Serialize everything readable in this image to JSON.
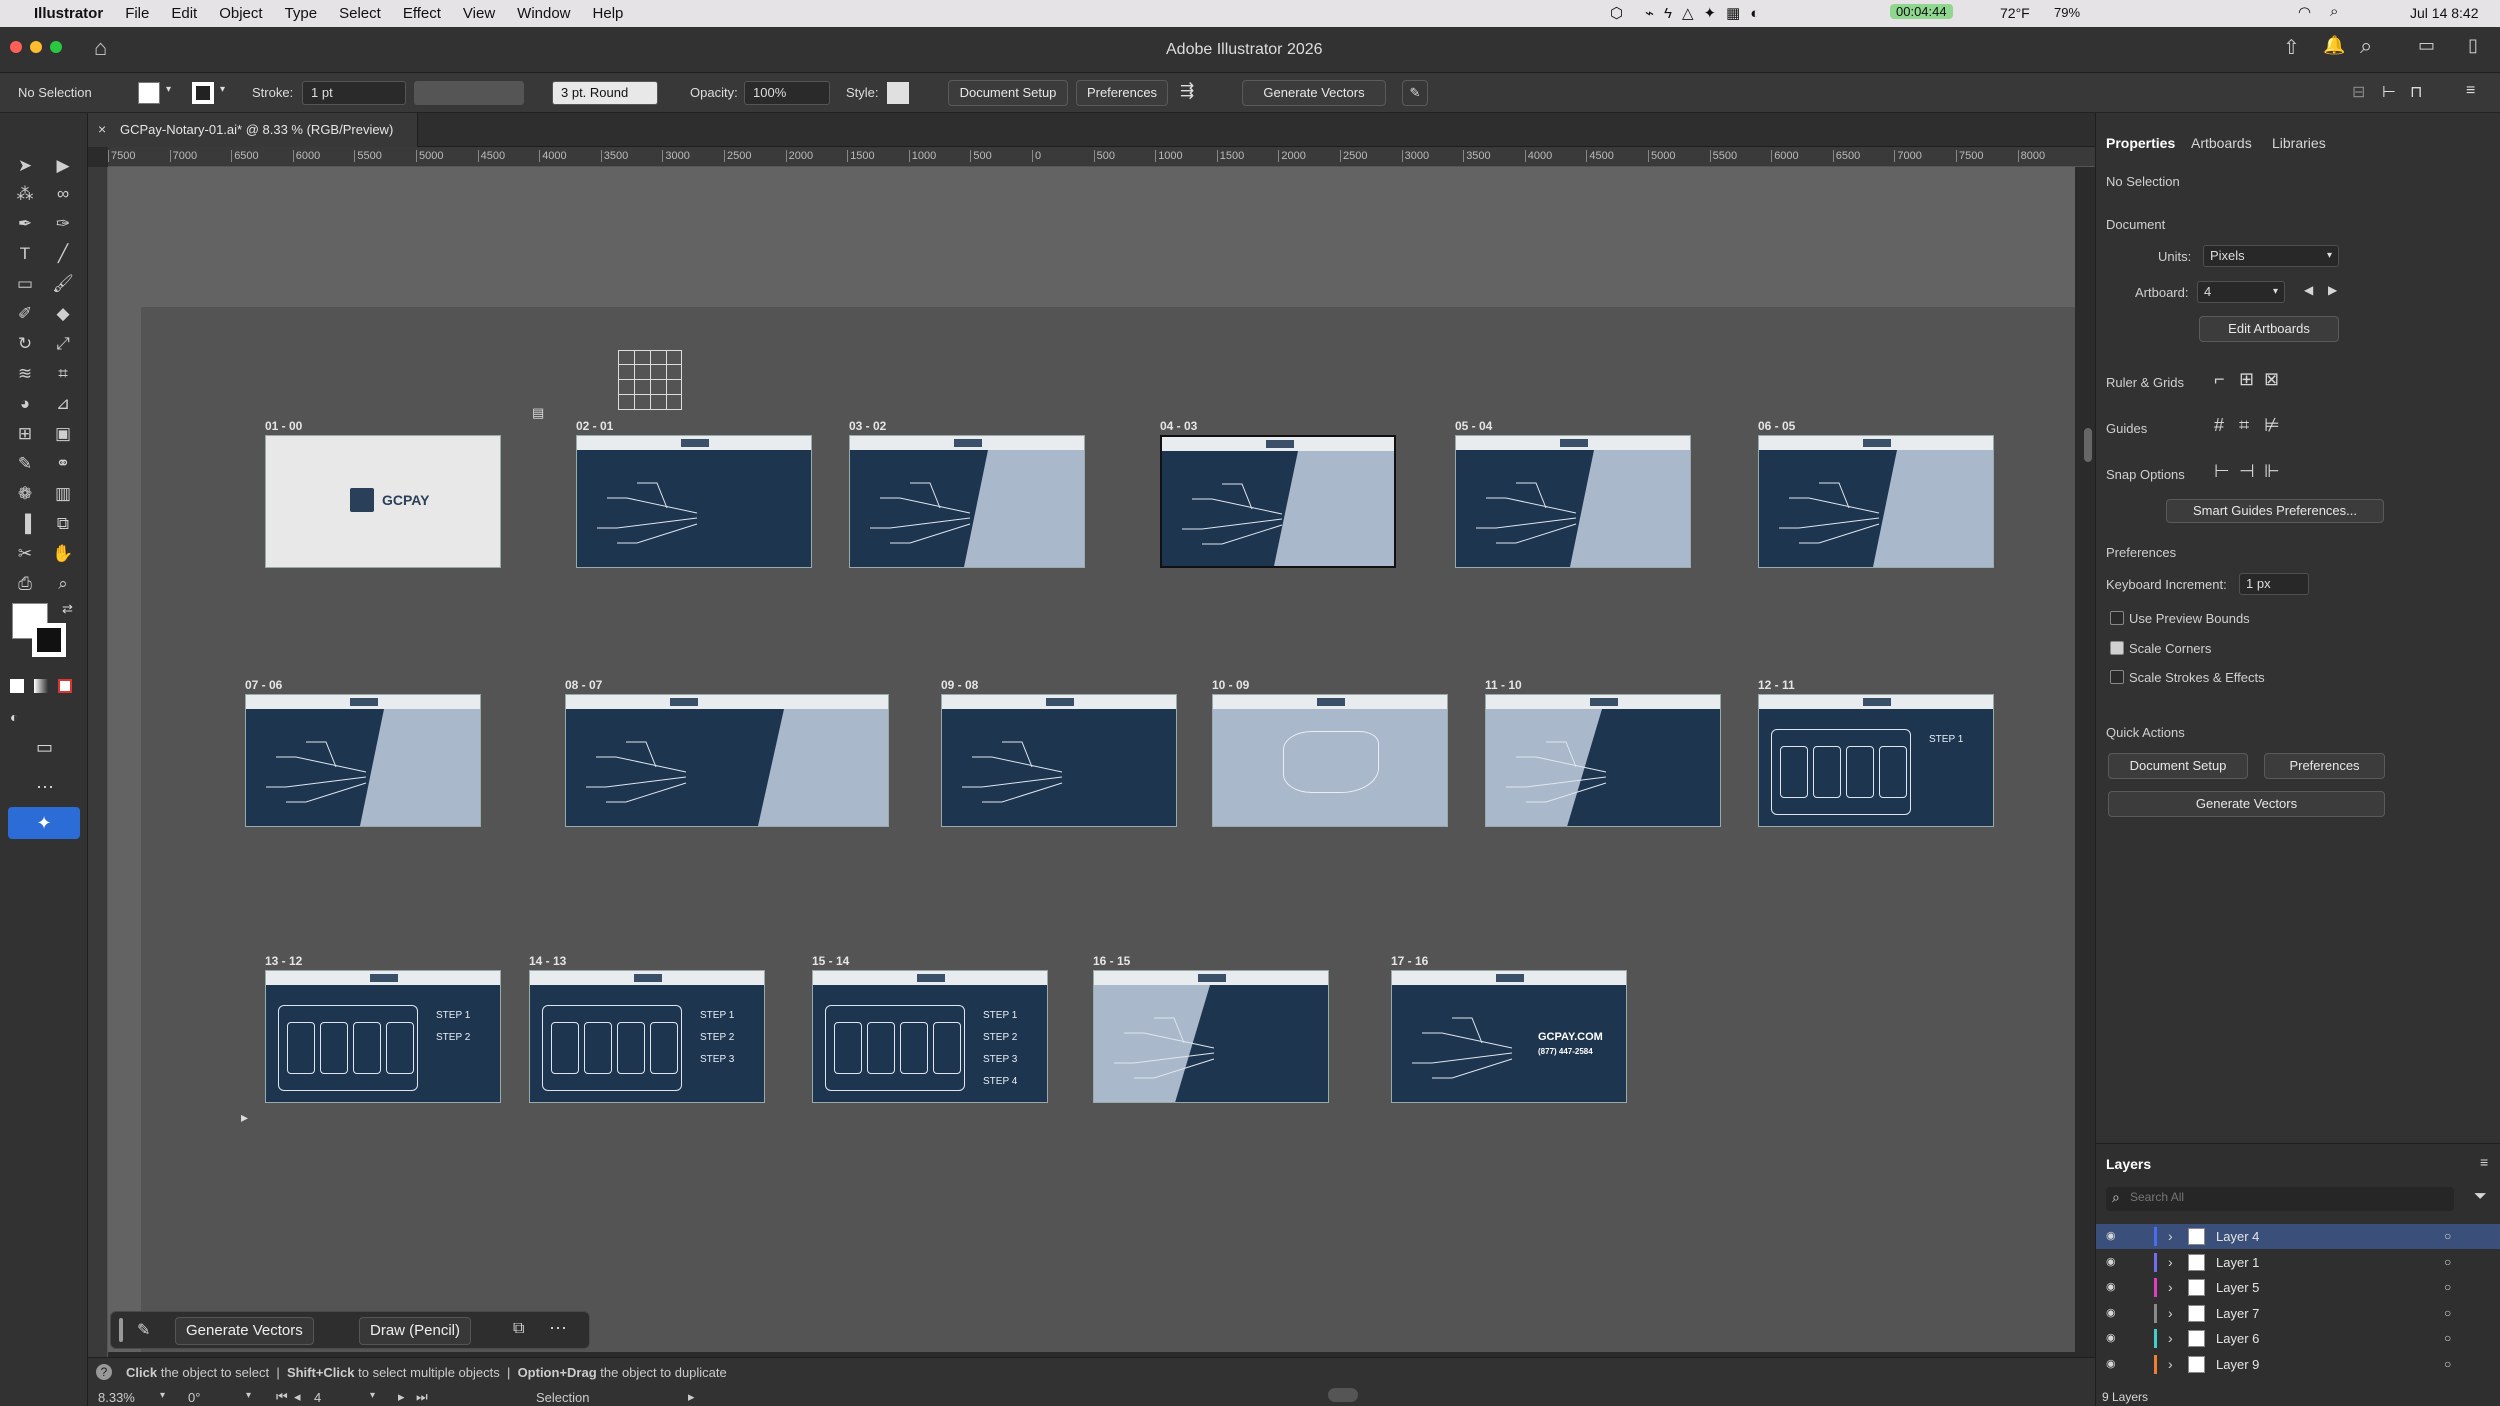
{
  "menubar": {
    "app": "Illustrator",
    "items": [
      "File",
      "Edit",
      "Object",
      "Type",
      "Select",
      "Effect",
      "View",
      "Window",
      "Help"
    ],
    "timer": "00:04:44",
    "weather": "72°F",
    "battery": "79%",
    "datetime": "Jul 14  8:42"
  },
  "window": {
    "title": "Adobe Illustrator 2026"
  },
  "control": {
    "selection": "No Selection",
    "stroke_label": "Stroke:",
    "stroke_value": "1 pt",
    "brush": "3 pt. Round",
    "opacity_label": "Opacity:",
    "opacity_value": "100%",
    "style_label": "Style:",
    "document_setup": "Document Setup",
    "preferences": "Preferences",
    "generate_vectors": "Generate Vectors"
  },
  "doc_tab": {
    "title": "GCPay-Notary-01.ai* @ 8.33 % (RGB/Preview)"
  },
  "ruler": {
    "h_ticks": [
      "7500",
      "7000",
      "6500",
      "6000",
      "5500",
      "5000",
      "4500",
      "4000",
      "3500",
      "3000",
      "2500",
      "2000",
      "1500",
      "1000",
      "500",
      "0",
      "500",
      "1000",
      "1500",
      "2000",
      "2500",
      "3000",
      "3500",
      "4000",
      "4500",
      "5000",
      "5500",
      "6000",
      "6500",
      "7000",
      "7500",
      "8000"
    ]
  },
  "artboards": [
    {
      "label": "01 - 00",
      "text": "GCPAY",
      "style": "cover"
    },
    {
      "label": "02 - 01",
      "style": "dark"
    },
    {
      "label": "03 - 02",
      "style": "split"
    },
    {
      "label": "04 - 03",
      "style": "split"
    },
    {
      "label": "05 - 04",
      "style": "split"
    },
    {
      "label": "06 - 05",
      "style": "split"
    },
    {
      "label": "07 - 06",
      "style": "split"
    },
    {
      "label": "08 - 07",
      "style": "split-wide"
    },
    {
      "label": "09 - 08",
      "style": "dark"
    },
    {
      "label": "10 - 09",
      "style": "light"
    },
    {
      "label": "11 - 10",
      "style": "split-left"
    },
    {
      "label": "12 - 11",
      "style": "steps",
      "step_text": "STEP 1"
    },
    {
      "label": "13 - 12",
      "style": "steps",
      "step_text": "STEP 1\nSTEP 2"
    },
    {
      "label": "14 - 13",
      "style": "steps",
      "step_text": "STEP 1\nSTEP 2\nSTEP 3"
    },
    {
      "label": "15 - 14",
      "style": "steps",
      "step_text": "STEP 1\nSTEP 2\nSTEP 3\nSTEP 4"
    },
    {
      "label": "16 - 15",
      "style": "split-left"
    },
    {
      "label": "17 - 16",
      "style": "contact",
      "url": "GCPAY.COM",
      "phone": "(877) 447-2584"
    }
  ],
  "right_panel": {
    "tabs": [
      "Properties",
      "Artboards",
      "Libraries"
    ],
    "no_selection": "No Selection",
    "document": "Document",
    "units_label": "Units:",
    "units_value": "Pixels",
    "artboard_label": "Artboard:",
    "artboard_value": "4",
    "edit_artboards": "Edit Artboards",
    "ruler_grids": "Ruler & Grids",
    "guides": "Guides",
    "snap_options": "Snap Options",
    "smart_guides": "Smart Guides Preferences...",
    "preferences_title": "Preferences",
    "keyboard_increment_label": "Keyboard Increment:",
    "keyboard_increment_value": "1 px",
    "use_preview_bounds": "Use Preview Bounds",
    "scale_corners": "Scale Corners",
    "scale_strokes": "Scale Strokes & Effects",
    "quick_actions": "Quick Actions",
    "qa_document_setup": "Document Setup",
    "qa_preferences": "Preferences",
    "qa_generate_vectors": "Generate Vectors"
  },
  "layers": {
    "title": "Layers",
    "search_placeholder": "Search All",
    "items": [
      {
        "name": "Layer 4",
        "color": "#4a6cf0",
        "selected": true
      },
      {
        "name": "Layer 1",
        "color": "#6f6ff0",
        "selected": false
      },
      {
        "name": "Layer 5",
        "color": "#e040c0",
        "selected": false
      },
      {
        "name": "Layer 7",
        "color": "#8a8a8a",
        "selected": false
      },
      {
        "name": "Layer 6",
        "color": "#40d0d0",
        "selected": false
      },
      {
        "name": "Layer 9",
        "color": "#f08030",
        "selected": false
      }
    ],
    "count": "9 Layers"
  },
  "context_bar": {
    "generate_vectors": "Generate Vectors",
    "draw_pencil": "Draw (Pencil)"
  },
  "status": {
    "hint_click": "Click",
    "hint_click_text": "the object to select",
    "hint_shift": "Shift+Click",
    "hint_shift_text": "to select multiple objects",
    "hint_option": "Option+Drag",
    "hint_option_text": "the object to duplicate",
    "zoom": "8.33%",
    "rotation": "0°",
    "artboard_nav": "4",
    "tool": "Selection"
  }
}
